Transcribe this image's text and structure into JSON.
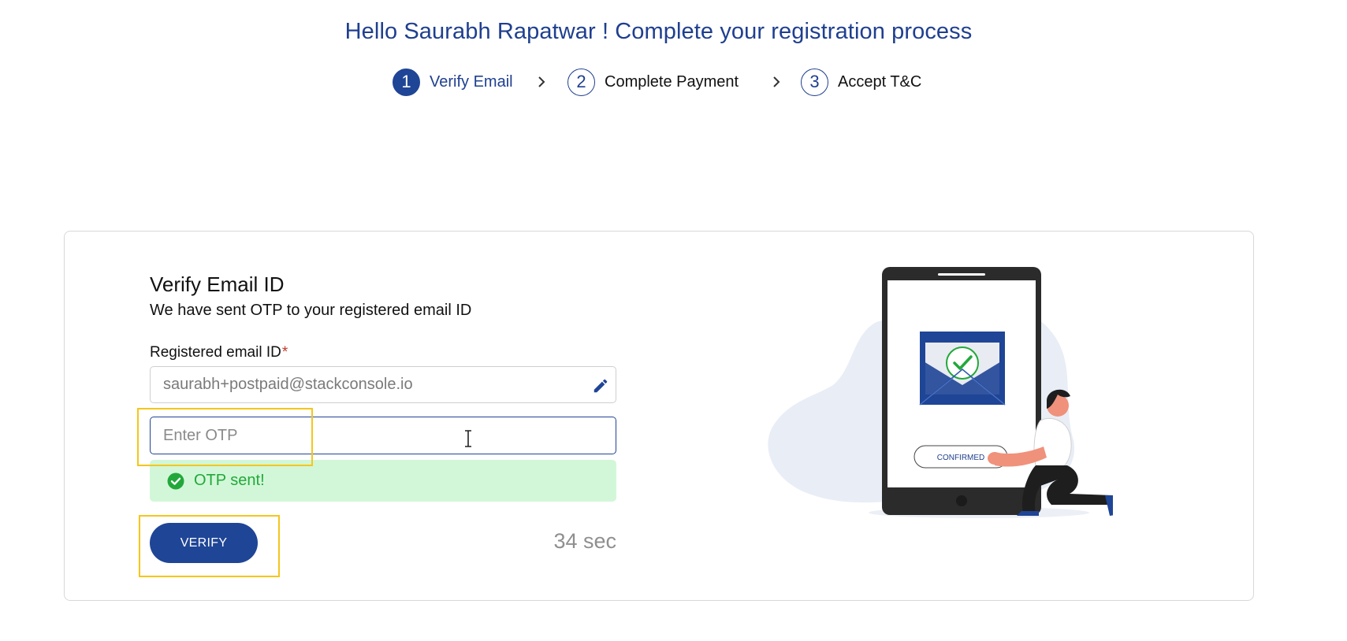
{
  "header": {
    "greeting": "Hello Saurabh Rapatwar ! Complete your registration process"
  },
  "stepper": {
    "steps": [
      {
        "number": "1",
        "label": "Verify Email",
        "state": "active"
      },
      {
        "number": "2",
        "label": "Complete Payment",
        "state": "pending"
      },
      {
        "number": "3",
        "label": "Accept T&C",
        "state": "pending"
      }
    ]
  },
  "verify_card": {
    "title": "Verify Email ID",
    "subtitle": "We have sent OTP to your registered email ID",
    "email_label": "Registered email ID",
    "required_mark": "*",
    "email_value": "saurabh+postpaid@stackconsole.io",
    "otp_placeholder": "Enter OTP",
    "otp_value": "",
    "alert_text": "OTP sent!",
    "verify_button_label": "VERIFY",
    "timer_text": "34 sec"
  },
  "illustration": {
    "badge_text": "CONFIRMED"
  },
  "colors": {
    "brand": "#1f4596",
    "success": "#22a83a",
    "success_bg": "#d2f7d8",
    "highlight": "#f5c61b"
  },
  "icons": {
    "edit": "pencil-icon",
    "success": "check-circle-icon",
    "step_separator": "chevron-right-icon"
  }
}
